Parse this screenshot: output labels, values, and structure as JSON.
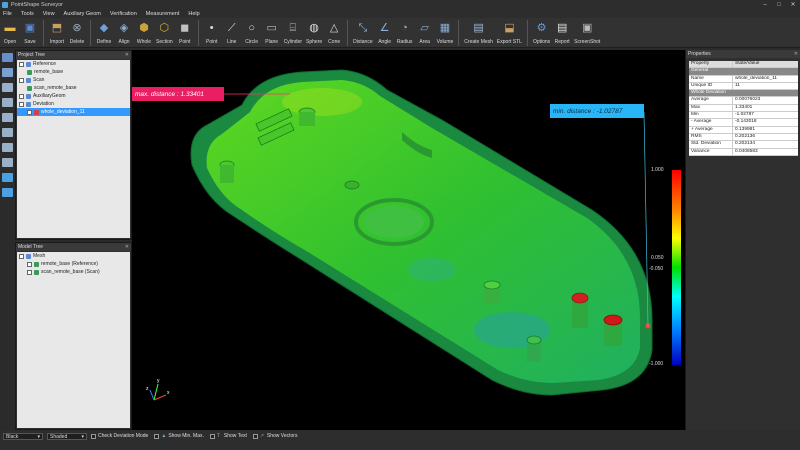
{
  "window": {
    "title": "PointShape Surveyor"
  },
  "menu": [
    "File",
    "Tools",
    "View",
    "Auxiliary Geom",
    "Verification",
    "Measurement",
    "Help"
  ],
  "toolbar": [
    {
      "label": "Open",
      "icon": "folder-open-icon",
      "color": "#e8b84a",
      "glyph": "▬"
    },
    {
      "label": "Save",
      "icon": "save-icon",
      "color": "#5a8ad0",
      "glyph": "▣"
    },
    {
      "sep": true
    },
    {
      "label": "Import",
      "icon": "import-icon",
      "color": "#c8a060",
      "glyph": "⬒"
    },
    {
      "label": "Delete",
      "icon": "delete-icon",
      "color": "#9aa6b8",
      "glyph": "⊗"
    },
    {
      "sep": true
    },
    {
      "label": "Define",
      "icon": "define-icon",
      "color": "#6fa0d8",
      "glyph": "◆"
    },
    {
      "label": "Align",
      "icon": "align-icon",
      "color": "#8ab0d8",
      "glyph": "◈"
    },
    {
      "label": "Whole",
      "icon": "whole-icon",
      "color": "#c9a23a",
      "glyph": "⬢"
    },
    {
      "label": "Section",
      "icon": "section-icon",
      "color": "#d8b040",
      "glyph": "⬡"
    },
    {
      "label": "Point",
      "icon": "point-cube-icon",
      "color": "#c0c0c0",
      "glyph": "◼"
    },
    {
      "sep": true
    },
    {
      "label": "Point",
      "icon": "point-icon",
      "color": "#dddddd",
      "glyph": "•"
    },
    {
      "label": "Line",
      "icon": "line-icon",
      "color": "#dddddd",
      "glyph": "⟋"
    },
    {
      "label": "Circle",
      "icon": "circle-icon",
      "color": "#dddddd",
      "glyph": "○"
    },
    {
      "label": "Plane",
      "icon": "plane-icon",
      "color": "#bbbbbb",
      "glyph": "▭"
    },
    {
      "label": "Cylinder",
      "icon": "cylinder-icon",
      "color": "#bbbbbb",
      "glyph": "⌸"
    },
    {
      "label": "Sphere",
      "icon": "sphere-icon",
      "color": "#dddddd",
      "glyph": "◍"
    },
    {
      "label": "Cone",
      "icon": "cone-icon",
      "color": "#dddddd",
      "glyph": "△"
    },
    {
      "sep": true
    },
    {
      "label": "Distance",
      "icon": "distance-icon",
      "color": "#8ab0d8",
      "glyph": "⤡"
    },
    {
      "label": "Angle",
      "icon": "angle-icon",
      "color": "#8ab0d8",
      "glyph": "∠"
    },
    {
      "label": "Radius",
      "icon": "radius-icon",
      "color": "#8ab0d8",
      "glyph": "◔"
    },
    {
      "label": "Area",
      "icon": "area-icon",
      "color": "#8ab0d8",
      "glyph": "▱"
    },
    {
      "label": "Volume",
      "icon": "volume-icon",
      "color": "#8ab0d8",
      "glyph": "▦"
    },
    {
      "sep": true
    },
    {
      "label": "Create Mesh",
      "icon": "create-mesh-icon",
      "color": "#9ab8d8",
      "glyph": "▤"
    },
    {
      "label": "Export STL",
      "icon": "export-stl-icon",
      "color": "#c8a060",
      "glyph": "⬓"
    },
    {
      "sep": true
    },
    {
      "label": "Options",
      "icon": "options-gear-icon",
      "color": "#5aa0e0",
      "glyph": "⚙"
    },
    {
      "label": "Report",
      "icon": "report-icon",
      "color": "#e0e0e0",
      "glyph": "▤"
    },
    {
      "label": "ScreenShot",
      "icon": "screenshot-icon",
      "color": "#bbbbbb",
      "glyph": "▣"
    }
  ],
  "project_tree": {
    "title": "Project Tree",
    "items": [
      {
        "label": "Reference",
        "indent": 0,
        "icon": "#5a8ad0",
        "check": true
      },
      {
        "label": "remote_base",
        "indent": 1,
        "icon": "#3a9a5a",
        "check": false
      },
      {
        "label": "Scan",
        "indent": 0,
        "icon": "#5a8ad0",
        "check": true
      },
      {
        "label": "scan_remote_base",
        "indent": 1,
        "icon": "#3a9a5a",
        "check": false
      },
      {
        "label": "AuxiliaryGeom",
        "indent": 0,
        "icon": "#5a8ad0",
        "check": true
      },
      {
        "label": "Deviation",
        "indent": 0,
        "icon": "#5a8ad0",
        "check": true
      },
      {
        "label": "whole_deviation_11",
        "indent": 1,
        "icon": "#d84040",
        "check": true,
        "selected": true
      }
    ]
  },
  "model_tree": {
    "title": "Model Tree",
    "items": [
      {
        "label": "Mesh",
        "indent": 0,
        "icon": "#5a8ad0",
        "check": true
      },
      {
        "label": "remote_base (Reference)",
        "indent": 1,
        "icon": "#3a9a5a",
        "check": true
      },
      {
        "label": "scan_remote_base (Scan)",
        "indent": 1,
        "icon": "#3a9a5a",
        "check": true
      }
    ]
  },
  "properties": {
    "title": "Properties",
    "header": {
      "k": "Property",
      "v": "State/Value"
    },
    "rows": [
      {
        "group": "General"
      },
      {
        "k": "Name",
        "v": "whole_deviation_11"
      },
      {
        "k": "Unique ID",
        "v": "11"
      },
      {
        "group": "Whole Deviation"
      },
      {
        "k": "Average",
        "v": "0.00076023"
      },
      {
        "k": "Max",
        "v": "1.33401"
      },
      {
        "k": "Min",
        "v": "-1.02787"
      },
      {
        "k": "- Average",
        "v": "-0.143018"
      },
      {
        "k": "+ Average",
        "v": "0.139981"
      },
      {
        "k": "RMS",
        "v": "0.202136"
      },
      {
        "k": "Std. Deviation",
        "v": "0.202134"
      },
      {
        "k": "Variance",
        "v": "0.0408583"
      }
    ]
  },
  "viewport": {
    "max_label": "max. distance : 1.33401",
    "min_label": "min. distance : -1.02787",
    "scale_labels": [
      "1.000",
      "0.050",
      "-0.050",
      "-1.000"
    ],
    "axes": {
      "x": "x",
      "y": "y",
      "z": "z"
    }
  },
  "statusbar": {
    "background": "Black",
    "shading": "Shaded",
    "check_deviation_mode": "Check Deviation Mode",
    "show_min_max": "Show Min. Max.",
    "show_text": "Show Text",
    "show_vectors": "Show Vectors"
  }
}
